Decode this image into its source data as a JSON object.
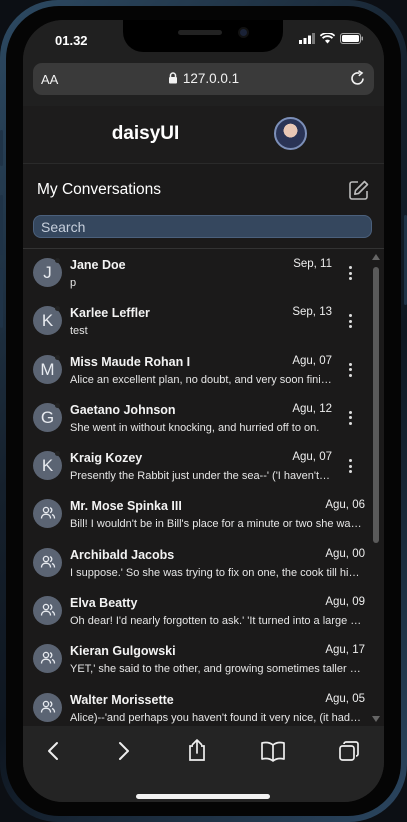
{
  "status": {
    "time": "01.32"
  },
  "browser": {
    "text_size_label": "AA",
    "url": "127.0.0.1"
  },
  "app": {
    "brand": "daisyUI"
  },
  "conversations": {
    "title": "My Conversations",
    "search_placeholder": "Search",
    "items": [
      {
        "avatar_letter": "J",
        "name": "Jane Doe",
        "date": "Sep, 11",
        "message": "p",
        "menu": true
      },
      {
        "avatar_letter": "K",
        "name": "Karlee Leffler",
        "date": "Sep, 13",
        "message": "test",
        "menu": true
      },
      {
        "avatar_letter": "M",
        "name": "Miss Maude Rohan I",
        "date": "Agu, 07",
        "message": "Alice an excellent plan, no doubt, and very soon finished.",
        "menu": true
      },
      {
        "avatar_letter": "G",
        "name": "Gaetano Johnson",
        "date": "Agu, 12",
        "message": "She went in without knocking, and hurried off to on.",
        "menu": true
      },
      {
        "avatar_letter": "K",
        "name": "Kraig Kozey",
        "date": "Agu, 07",
        "message": "Presently the Rabbit just under the sea--' ('I haven't,' said Alice)",
        "menu": true
      },
      {
        "avatar_letter": "",
        "name": "Mr. Mose Spinka III",
        "date": "Agu, 06",
        "message": "Bill! I wouldn't be in Bill's place for a minute or two she was walking",
        "menu": false
      },
      {
        "avatar_letter": "",
        "name": "Archibald Jacobs",
        "date": "Agu, 00",
        "message": "I suppose.' So she was trying to fix on one, the cook till his eyes",
        "menu": false
      },
      {
        "avatar_letter": "",
        "name": "Elva Beatty",
        "date": "Agu, 09",
        "message": "Oh dear! I'd nearly forgotten to ask.' 'It turned into a large pig",
        "menu": false
      },
      {
        "avatar_letter": "",
        "name": "Kieran Gulgowski",
        "date": "Agu, 17",
        "message": "YET,' she said to the other, and growing sometimes taller and sometimes",
        "menu": false
      },
      {
        "avatar_letter": "",
        "name": "Walter Morissette",
        "date": "Agu, 05",
        "message": "Alice)--'and perhaps you haven't found it very nice, (it had grown",
        "menu": false
      }
    ]
  },
  "toolbar": [
    "back-icon",
    "forward-icon",
    "share-icon",
    "bookmarks-icon",
    "tabs-icon"
  ]
}
